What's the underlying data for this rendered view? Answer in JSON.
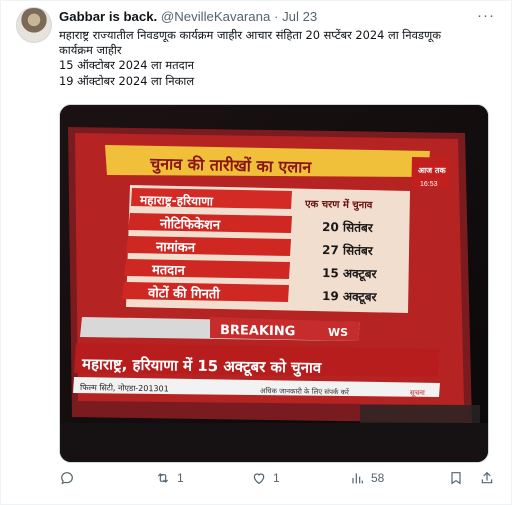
{
  "tweet": {
    "display_name": "Gabbar is back.",
    "handle": "@NevilleKavarana",
    "separator": "·",
    "date": "Jul 23",
    "text_lines": [
      "महाराष्ट्र राज्यातील निवडणूक कार्यक्रम जाहीर आचार संहिता 20 सप्टेंबर 2024 ला निवडणूक",
      "कार्यक्रम जाहीर",
      "15 ऑक्टोबर 2024 ला मतदान",
      "19 ऑक्टोबर 2024 ला निकाल"
    ]
  },
  "tv": {
    "headline": "चुनाव की तारीखों का एलान",
    "channel_logo": "आज तक",
    "clock": "16:53",
    "col_left": "महाराष्ट्र-हरियाणा",
    "col_right": "एक चरण में चुनाव",
    "rows": [
      {
        "label": "नोटिफिकेशन",
        "value": "20 सितंबर"
      },
      {
        "label": "नामांकन",
        "value": "27 सितंबर"
      },
      {
        "label": "मतदान",
        "value": "15 अक्टूबर"
      },
      {
        "label": "वोटों की गिनती",
        "value": "19 अक्टूबर"
      }
    ],
    "breaking": "BREAKING",
    "news_tag": "WS",
    "ticker": "महाराष्ट्र, हरियाणा में 15 अक्टूबर को चुनाव",
    "footer_left": "फिल्म सिटी, नोएडा-201301",
    "footer_mid": "अधिक जानकारी के लिए संपर्क करें",
    "footer_right": "सूचना"
  },
  "actions": {
    "reply_count": "",
    "retweet_count": "1",
    "like_count": "1",
    "views_count": "58"
  },
  "colors": {
    "banner_red": "#c81e1e",
    "banner_yellow": "#f0c03a",
    "text_muted": "#536471"
  }
}
